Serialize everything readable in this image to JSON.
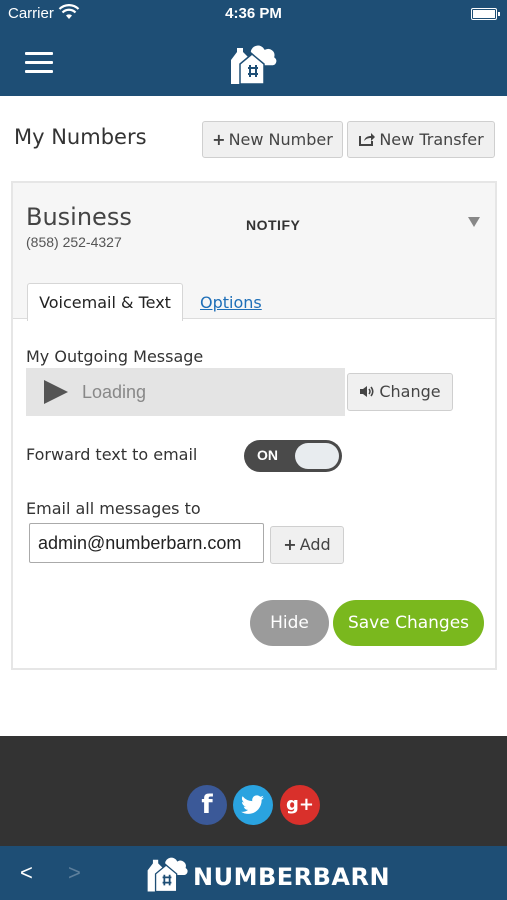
{
  "status_bar": {
    "carrier": "Carrier",
    "time": "4:36 PM"
  },
  "header": {
    "menu_icon": "hamburger-menu-icon",
    "logo_icon": "barn-logo-icon"
  },
  "page": {
    "title": "My Numbers",
    "new_number_label": "New Number",
    "new_transfer_label": "New Transfer"
  },
  "number_card": {
    "name": "Business",
    "phone": "(858) 252-4327",
    "mode": "NOTIFY",
    "tabs": [
      {
        "label": "Voicemail & Text",
        "active": true
      },
      {
        "label": "Options",
        "active": false
      }
    ],
    "outgoing_label": "My Outgoing Message",
    "player_status": "Loading",
    "change_label": "Change",
    "forward_label": "Forward text to email",
    "forward_toggle": "ON",
    "email_label": "Email all messages to",
    "email_value": "admin@numberbarn.com",
    "add_label": "Add",
    "hide_label": "Hide",
    "save_label": "Save Changes"
  },
  "footer": {
    "social": [
      {
        "name": "facebook",
        "glyph": "f",
        "color": "#3b5998"
      },
      {
        "name": "twitter",
        "glyph": "t",
        "color": "#2aa3e0"
      },
      {
        "name": "google-plus",
        "glyph": "g+",
        "color": "#d9302b"
      }
    ]
  },
  "bottom_bar": {
    "back": "<",
    "forward": ">",
    "brand": "NUMBERBARN"
  },
  "colors": {
    "nav": "#1e4e75",
    "save": "#7ab81e",
    "footer": "#333333",
    "link": "#1e6fb8"
  }
}
